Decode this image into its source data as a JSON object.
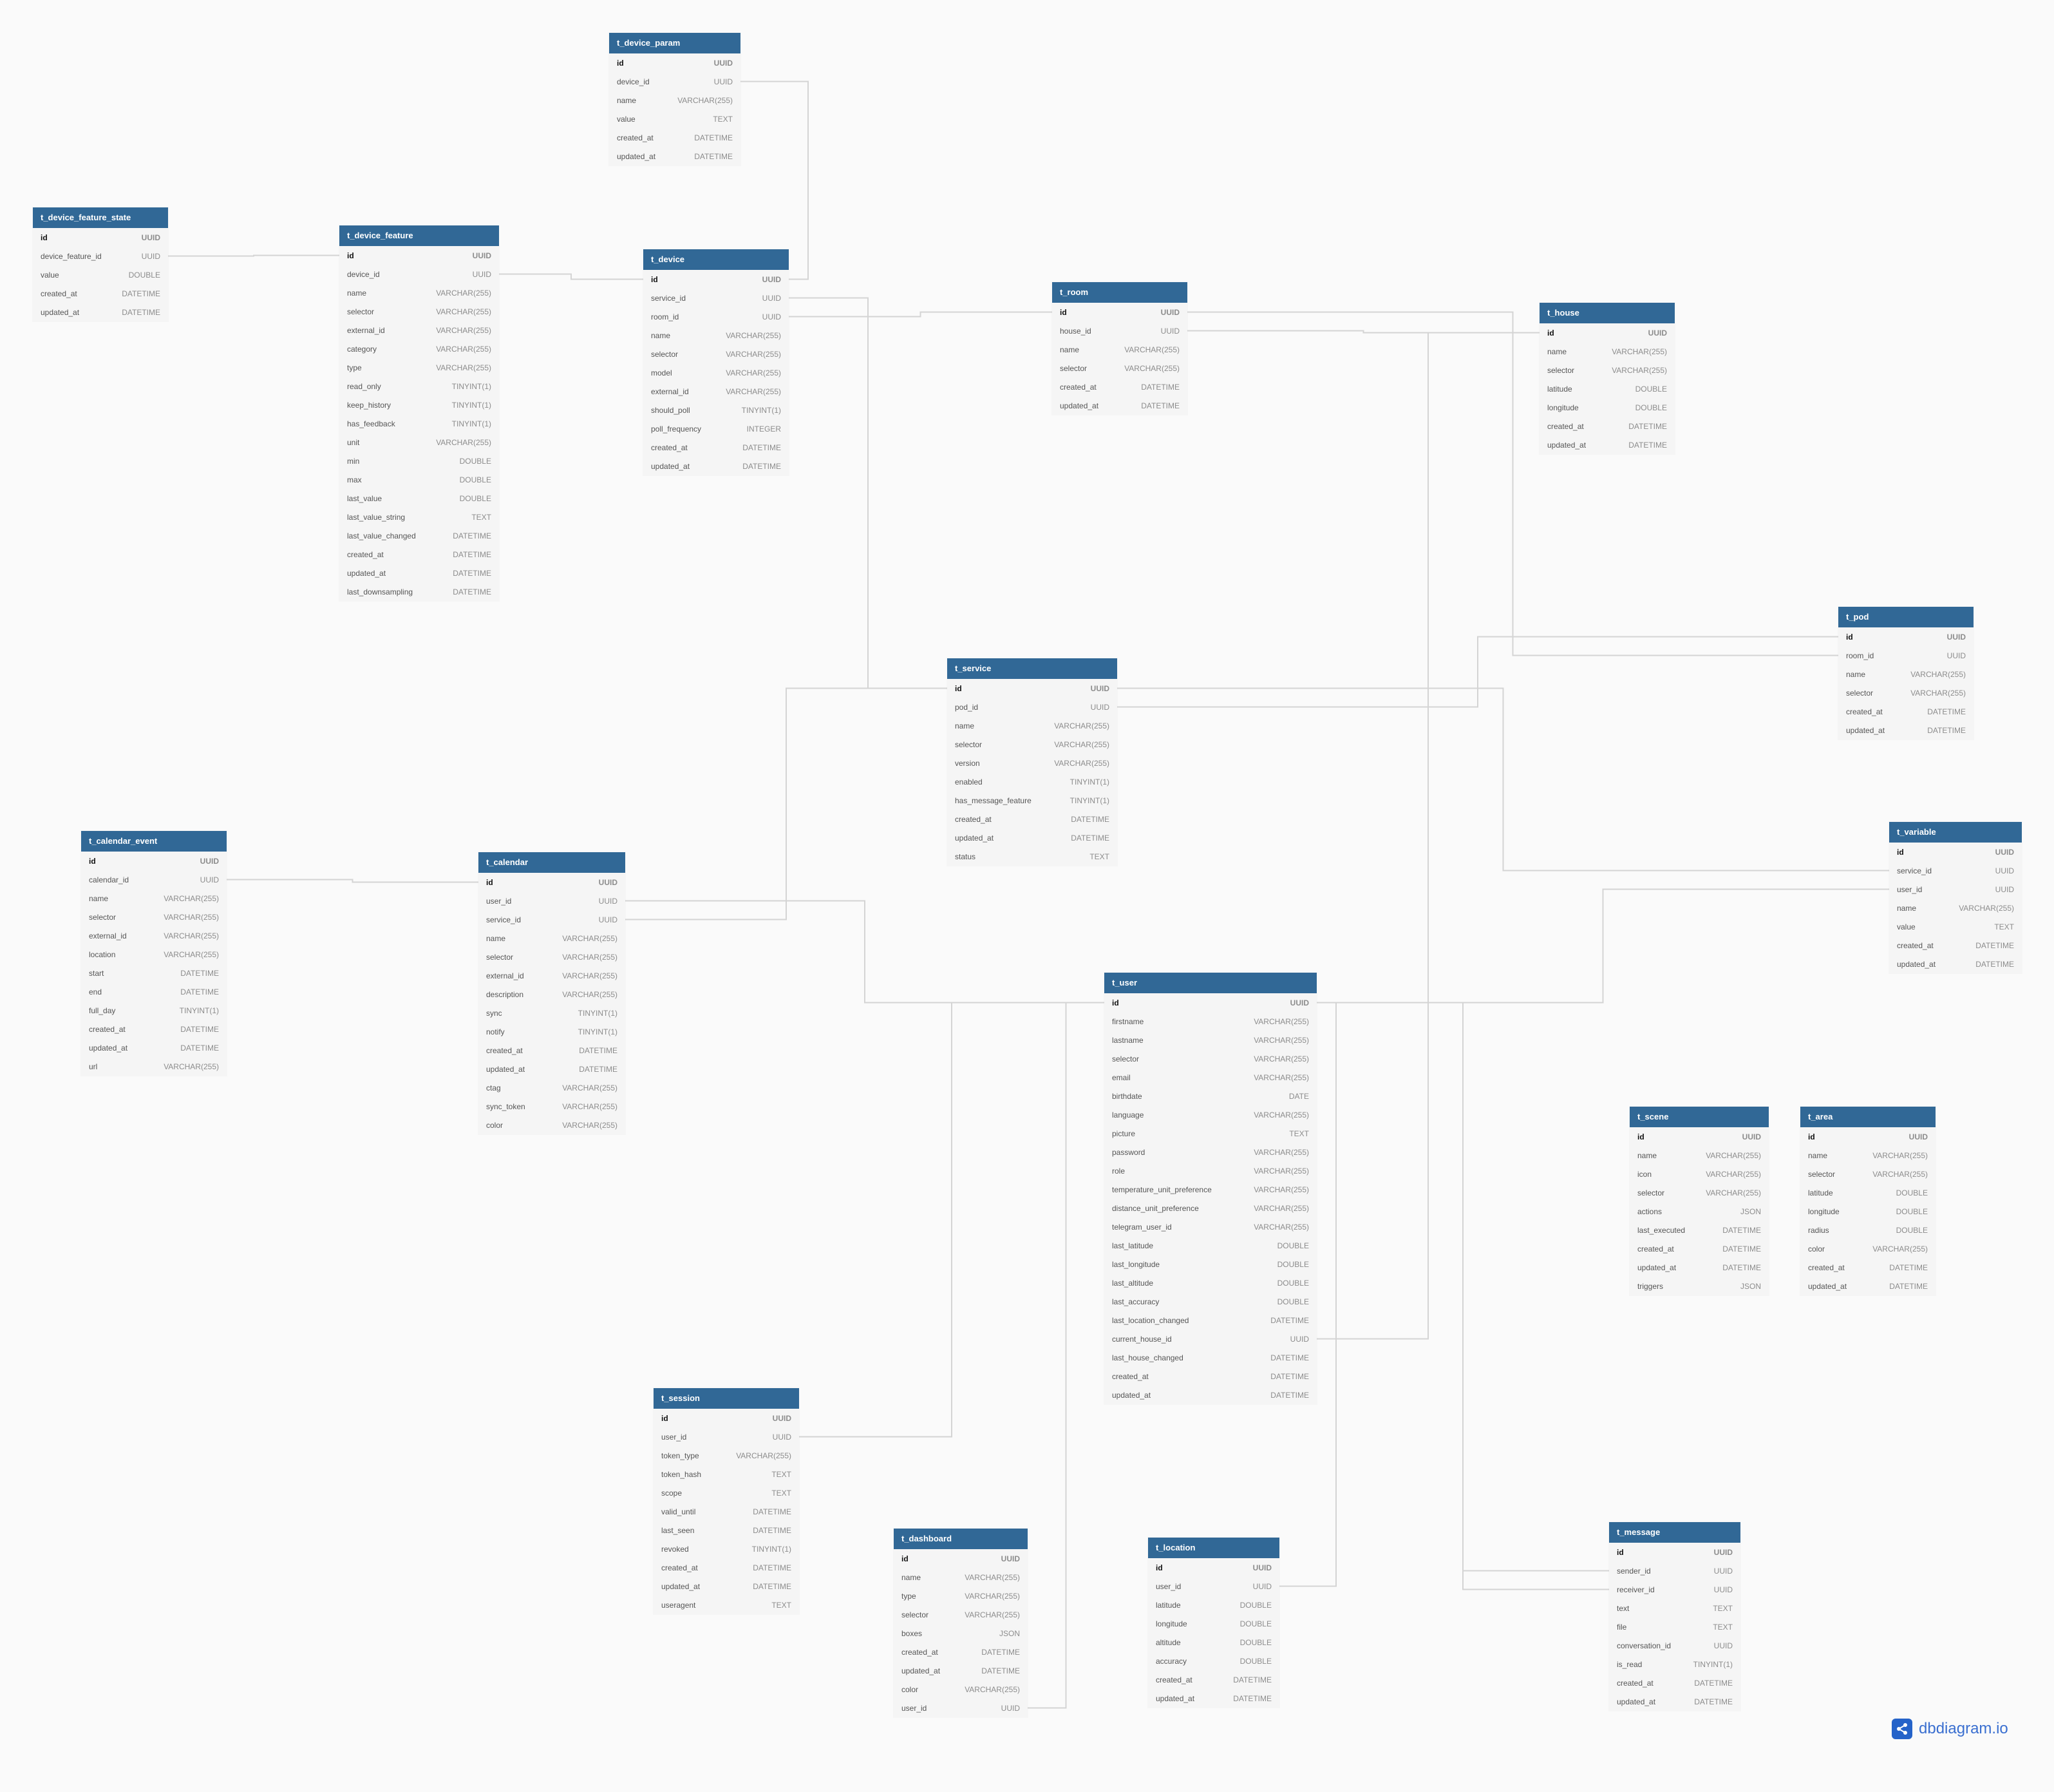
{
  "brand": {
    "name": "dbdiagram.io",
    "icon": "share-nodes-icon"
  },
  "colors": {
    "header": "#316896",
    "table_bg": "#f5f5f5",
    "canvas": "#fafafa",
    "link": "#d4d4d4",
    "brand": "#2563c9"
  },
  "tables": [
    {
      "name": "t_device_param",
      "fields": [
        [
          "id",
          "UUID"
        ],
        [
          "device_id",
          "UUID"
        ],
        [
          "name",
          "VARCHAR(255)"
        ],
        [
          "value",
          "TEXT"
        ],
        [
          "created_at",
          "DATETIME"
        ],
        [
          "updated_at",
          "DATETIME"
        ]
      ]
    },
    {
      "name": "t_device_feature_state",
      "fields": [
        [
          "id",
          "UUID"
        ],
        [
          "device_feature_id",
          "UUID"
        ],
        [
          "value",
          "DOUBLE"
        ],
        [
          "created_at",
          "DATETIME"
        ],
        [
          "updated_at",
          "DATETIME"
        ]
      ]
    },
    {
      "name": "t_device_feature",
      "fields": [
        [
          "id",
          "UUID"
        ],
        [
          "device_id",
          "UUID"
        ],
        [
          "name",
          "VARCHAR(255)"
        ],
        [
          "selector",
          "VARCHAR(255)"
        ],
        [
          "external_id",
          "VARCHAR(255)"
        ],
        [
          "category",
          "VARCHAR(255)"
        ],
        [
          "type",
          "VARCHAR(255)"
        ],
        [
          "read_only",
          "TINYINT(1)"
        ],
        [
          "keep_history",
          "TINYINT(1)"
        ],
        [
          "has_feedback",
          "TINYINT(1)"
        ],
        [
          "unit",
          "VARCHAR(255)"
        ],
        [
          "min",
          "DOUBLE"
        ],
        [
          "max",
          "DOUBLE"
        ],
        [
          "last_value",
          "DOUBLE"
        ],
        [
          "last_value_string",
          "TEXT"
        ],
        [
          "last_value_changed",
          "DATETIME"
        ],
        [
          "created_at",
          "DATETIME"
        ],
        [
          "updated_at",
          "DATETIME"
        ],
        [
          "last_downsampling",
          "DATETIME"
        ]
      ]
    },
    {
      "name": "t_device",
      "fields": [
        [
          "id",
          "UUID"
        ],
        [
          "service_id",
          "UUID"
        ],
        [
          "room_id",
          "UUID"
        ],
        [
          "name",
          "VARCHAR(255)"
        ],
        [
          "selector",
          "VARCHAR(255)"
        ],
        [
          "model",
          "VARCHAR(255)"
        ],
        [
          "external_id",
          "VARCHAR(255)"
        ],
        [
          "should_poll",
          "TINYINT(1)"
        ],
        [
          "poll_frequency",
          "INTEGER"
        ],
        [
          "created_at",
          "DATETIME"
        ],
        [
          "updated_at",
          "DATETIME"
        ]
      ]
    },
    {
      "name": "t_room",
      "fields": [
        [
          "id",
          "UUID"
        ],
        [
          "house_id",
          "UUID"
        ],
        [
          "name",
          "VARCHAR(255)"
        ],
        [
          "selector",
          "VARCHAR(255)"
        ],
        [
          "created_at",
          "DATETIME"
        ],
        [
          "updated_at",
          "DATETIME"
        ]
      ]
    },
    {
      "name": "t_house",
      "fields": [
        [
          "id",
          "UUID"
        ],
        [
          "name",
          "VARCHAR(255)"
        ],
        [
          "selector",
          "VARCHAR(255)"
        ],
        [
          "latitude",
          "DOUBLE"
        ],
        [
          "longitude",
          "DOUBLE"
        ],
        [
          "created_at",
          "DATETIME"
        ],
        [
          "updated_at",
          "DATETIME"
        ]
      ]
    },
    {
      "name": "t_pod",
      "fields": [
        [
          "id",
          "UUID"
        ],
        [
          "room_id",
          "UUID"
        ],
        [
          "name",
          "VARCHAR(255)"
        ],
        [
          "selector",
          "VARCHAR(255)"
        ],
        [
          "created_at",
          "DATETIME"
        ],
        [
          "updated_at",
          "DATETIME"
        ]
      ]
    },
    {
      "name": "t_service",
      "fields": [
        [
          "id",
          "UUID"
        ],
        [
          "pod_id",
          "UUID"
        ],
        [
          "name",
          "VARCHAR(255)"
        ],
        [
          "selector",
          "VARCHAR(255)"
        ],
        [
          "version",
          "VARCHAR(255)"
        ],
        [
          "enabled",
          "TINYINT(1)"
        ],
        [
          "has_message_feature",
          "TINYINT(1)"
        ],
        [
          "created_at",
          "DATETIME"
        ],
        [
          "updated_at",
          "DATETIME"
        ],
        [
          "status",
          "TEXT"
        ]
      ]
    },
    {
      "name": "t_calendar_event",
      "fields": [
        [
          "id",
          "UUID"
        ],
        [
          "calendar_id",
          "UUID"
        ],
        [
          "name",
          "VARCHAR(255)"
        ],
        [
          "selector",
          "VARCHAR(255)"
        ],
        [
          "external_id",
          "VARCHAR(255)"
        ],
        [
          "location",
          "VARCHAR(255)"
        ],
        [
          "start",
          "DATETIME"
        ],
        [
          "end",
          "DATETIME"
        ],
        [
          "full_day",
          "TINYINT(1)"
        ],
        [
          "created_at",
          "DATETIME"
        ],
        [
          "updated_at",
          "DATETIME"
        ],
        [
          "url",
          "VARCHAR(255)"
        ]
      ]
    },
    {
      "name": "t_calendar",
      "fields": [
        [
          "id",
          "UUID"
        ],
        [
          "user_id",
          "UUID"
        ],
        [
          "service_id",
          "UUID"
        ],
        [
          "name",
          "VARCHAR(255)"
        ],
        [
          "selector",
          "VARCHAR(255)"
        ],
        [
          "external_id",
          "VARCHAR(255)"
        ],
        [
          "description",
          "VARCHAR(255)"
        ],
        [
          "sync",
          "TINYINT(1)"
        ],
        [
          "notify",
          "TINYINT(1)"
        ],
        [
          "created_at",
          "DATETIME"
        ],
        [
          "updated_at",
          "DATETIME"
        ],
        [
          "ctag",
          "VARCHAR(255)"
        ],
        [
          "sync_token",
          "VARCHAR(255)"
        ],
        [
          "color",
          "VARCHAR(255)"
        ]
      ]
    },
    {
      "name": "t_variable",
      "fields": [
        [
          "id",
          "UUID"
        ],
        [
          "service_id",
          "UUID"
        ],
        [
          "user_id",
          "UUID"
        ],
        [
          "name",
          "VARCHAR(255)"
        ],
        [
          "value",
          "TEXT"
        ],
        [
          "created_at",
          "DATETIME"
        ],
        [
          "updated_at",
          "DATETIME"
        ]
      ]
    },
    {
      "name": "t_user",
      "fields": [
        [
          "id",
          "UUID"
        ],
        [
          "firstname",
          "VARCHAR(255)"
        ],
        [
          "lastname",
          "VARCHAR(255)"
        ],
        [
          "selector",
          "VARCHAR(255)"
        ],
        [
          "email",
          "VARCHAR(255)"
        ],
        [
          "birthdate",
          "DATE"
        ],
        [
          "language",
          "VARCHAR(255)"
        ],
        [
          "picture",
          "TEXT"
        ],
        [
          "password",
          "VARCHAR(255)"
        ],
        [
          "role",
          "VARCHAR(255)"
        ],
        [
          "temperature_unit_preference",
          "VARCHAR(255)"
        ],
        [
          "distance_unit_preference",
          "VARCHAR(255)"
        ],
        [
          "telegram_user_id",
          "VARCHAR(255)"
        ],
        [
          "last_latitude",
          "DOUBLE"
        ],
        [
          "last_longitude",
          "DOUBLE"
        ],
        [
          "last_altitude",
          "DOUBLE"
        ],
        [
          "last_accuracy",
          "DOUBLE"
        ],
        [
          "last_location_changed",
          "DATETIME"
        ],
        [
          "current_house_id",
          "UUID"
        ],
        [
          "last_house_changed",
          "DATETIME"
        ],
        [
          "created_at",
          "DATETIME"
        ],
        [
          "updated_at",
          "DATETIME"
        ]
      ]
    },
    {
      "name": "t_scene",
      "fields": [
        [
          "id",
          "UUID"
        ],
        [
          "name",
          "VARCHAR(255)"
        ],
        [
          "icon",
          "VARCHAR(255)"
        ],
        [
          "selector",
          "VARCHAR(255)"
        ],
        [
          "actions",
          "JSON"
        ],
        [
          "last_executed",
          "DATETIME"
        ],
        [
          "created_at",
          "DATETIME"
        ],
        [
          "updated_at",
          "DATETIME"
        ],
        [
          "triggers",
          "JSON"
        ]
      ]
    },
    {
      "name": "t_area",
      "fields": [
        [
          "id",
          "UUID"
        ],
        [
          "name",
          "VARCHAR(255)"
        ],
        [
          "selector",
          "VARCHAR(255)"
        ],
        [
          "latitude",
          "DOUBLE"
        ],
        [
          "longitude",
          "DOUBLE"
        ],
        [
          "radius",
          "DOUBLE"
        ],
        [
          "color",
          "VARCHAR(255)"
        ],
        [
          "created_at",
          "DATETIME"
        ],
        [
          "updated_at",
          "DATETIME"
        ]
      ]
    },
    {
      "name": "t_session",
      "fields": [
        [
          "id",
          "UUID"
        ],
        [
          "user_id",
          "UUID"
        ],
        [
          "token_type",
          "VARCHAR(255)"
        ],
        [
          "token_hash",
          "TEXT"
        ],
        [
          "scope",
          "TEXT"
        ],
        [
          "valid_until",
          "DATETIME"
        ],
        [
          "last_seen",
          "DATETIME"
        ],
        [
          "revoked",
          "TINYINT(1)"
        ],
        [
          "created_at",
          "DATETIME"
        ],
        [
          "updated_at",
          "DATETIME"
        ],
        [
          "useragent",
          "TEXT"
        ]
      ]
    },
    {
      "name": "t_dashboard",
      "fields": [
        [
          "id",
          "UUID"
        ],
        [
          "name",
          "VARCHAR(255)"
        ],
        [
          "type",
          "VARCHAR(255)"
        ],
        [
          "selector",
          "VARCHAR(255)"
        ],
        [
          "boxes",
          "JSON"
        ],
        [
          "created_at",
          "DATETIME"
        ],
        [
          "updated_at",
          "DATETIME"
        ],
        [
          "color",
          "VARCHAR(255)"
        ],
        [
          "user_id",
          "UUID"
        ]
      ]
    },
    {
      "name": "t_location",
      "fields": [
        [
          "id",
          "UUID"
        ],
        [
          "user_id",
          "UUID"
        ],
        [
          "latitude",
          "DOUBLE"
        ],
        [
          "longitude",
          "DOUBLE"
        ],
        [
          "altitude",
          "DOUBLE"
        ],
        [
          "accuracy",
          "DOUBLE"
        ],
        [
          "created_at",
          "DATETIME"
        ],
        [
          "updated_at",
          "DATETIME"
        ]
      ]
    },
    {
      "name": "t_message",
      "fields": [
        [
          "id",
          "UUID"
        ],
        [
          "sender_id",
          "UUID"
        ],
        [
          "receiver_id",
          "UUID"
        ],
        [
          "text",
          "TEXT"
        ],
        [
          "file",
          "TEXT"
        ],
        [
          "conversation_id",
          "UUID"
        ],
        [
          "is_read",
          "TINYINT(1)"
        ],
        [
          "created_at",
          "DATETIME"
        ],
        [
          "updated_at",
          "DATETIME"
        ]
      ]
    }
  ],
  "relations": [
    [
      "t_device_param.device_id",
      "t_device.id"
    ],
    [
      "t_device_feature_state.device_feature_id",
      "t_device_feature.id"
    ],
    [
      "t_device_feature.device_id",
      "t_device.id"
    ],
    [
      "t_device.service_id",
      "t_service.id"
    ],
    [
      "t_device.room_id",
      "t_room.id"
    ],
    [
      "t_room.house_id",
      "t_house.id"
    ],
    [
      "t_pod.room_id",
      "t_room.id"
    ],
    [
      "t_service.pod_id",
      "t_pod.id"
    ],
    [
      "t_calendar_event.calendar_id",
      "t_calendar.id"
    ],
    [
      "t_calendar.user_id",
      "t_user.id"
    ],
    [
      "t_calendar.service_id",
      "t_service.id"
    ],
    [
      "t_variable.service_id",
      "t_service.id"
    ],
    [
      "t_variable.user_id",
      "t_user.id"
    ],
    [
      "t_user.current_house_id",
      "t_house.id"
    ],
    [
      "t_session.user_id",
      "t_user.id"
    ],
    [
      "t_dashboard.user_id",
      "t_user.id"
    ],
    [
      "t_location.user_id",
      "t_user.id"
    ],
    [
      "t_message.sender_id",
      "t_user.id"
    ],
    [
      "t_message.receiver_id",
      "t_user.id"
    ]
  ]
}
